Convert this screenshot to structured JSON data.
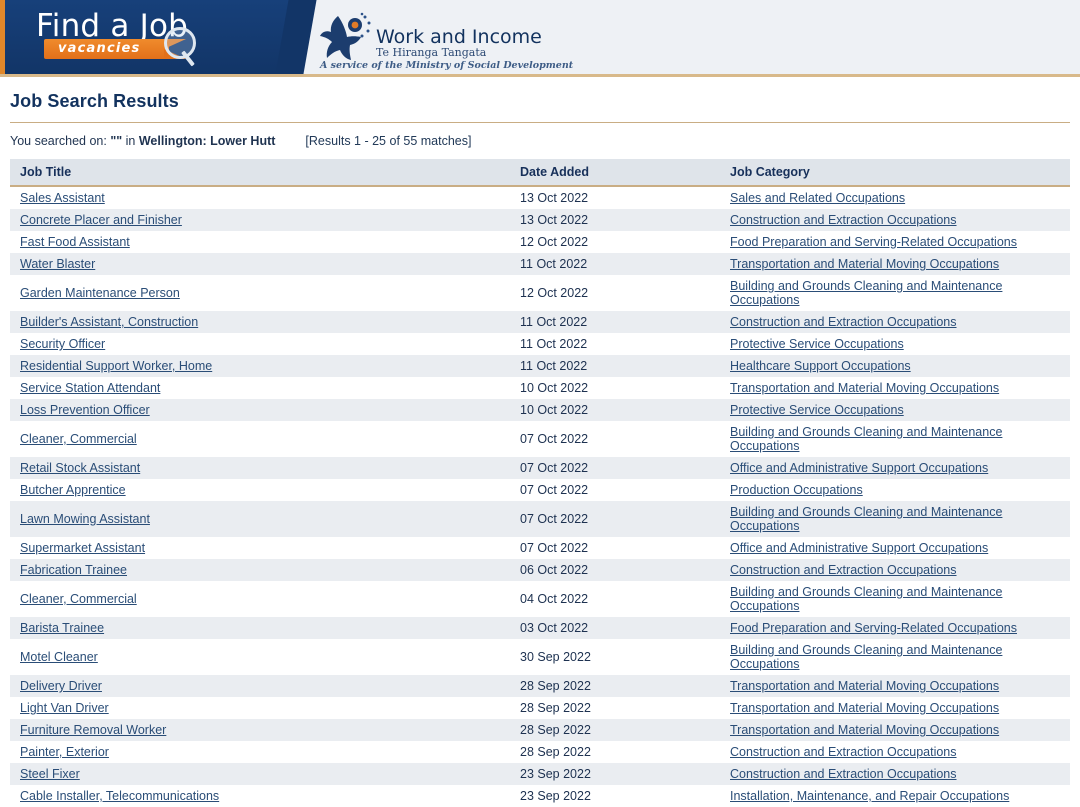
{
  "masthead": {
    "brand_logo_text": "Find a Job",
    "brand_banner_text": "vacancies",
    "agency_name": "Work and Income",
    "agency_maori_name": "Te Hiranga Tangata",
    "agency_tagline": "A service of the Ministry of Social Development",
    "navy": "#123567",
    "orange": "#e0872a",
    "rule_color": "#d8b98a"
  },
  "page": {
    "title": "Job Search Results",
    "searched_label": "You searched on: ",
    "searched_query": "\"\"",
    "searched_in": " in ",
    "searched_location": "Wellington: Lower Hutt",
    "results_count": "[Results 1 - 25 of 55 matches]"
  },
  "table": {
    "headers": {
      "job_title": "Job Title",
      "date_added": "Date Added",
      "job_category": "Job Category"
    },
    "rows": [
      {
        "title": "Sales Assistant",
        "date": "13 Oct 2022",
        "category": "Sales and Related Occupations"
      },
      {
        "title": "Concrete Placer and Finisher",
        "date": "13 Oct 2022",
        "category": "Construction and Extraction Occupations"
      },
      {
        "title": "Fast Food Assistant",
        "date": "12 Oct 2022",
        "category": "Food Preparation and Serving-Related Occupations"
      },
      {
        "title": "Water Blaster",
        "date": "11 Oct 2022",
        "category": "Transportation and Material Moving Occupations"
      },
      {
        "title": "Garden Maintenance Person",
        "date": "12 Oct 2022",
        "category": "Building and Grounds Cleaning and Maintenance Occupations"
      },
      {
        "title": "Builder's Assistant, Construction",
        "date": "11 Oct 2022",
        "category": "Construction and Extraction Occupations"
      },
      {
        "title": "Security Officer",
        "date": "11 Oct 2022",
        "category": "Protective Service Occupations"
      },
      {
        "title": "Residential Support Worker, Home",
        "date": "11 Oct 2022",
        "category": "Healthcare Support Occupations"
      },
      {
        "title": "Service Station Attendant",
        "date": "10 Oct 2022",
        "category": "Transportation and Material Moving Occupations"
      },
      {
        "title": "Loss Prevention Officer",
        "date": "10 Oct 2022",
        "category": "Protective Service Occupations"
      },
      {
        "title": "Cleaner, Commercial",
        "date": "07 Oct 2022",
        "category": "Building and Grounds Cleaning and Maintenance Occupations"
      },
      {
        "title": "Retail Stock Assistant",
        "date": "07 Oct 2022",
        "category": "Office and Administrative Support Occupations"
      },
      {
        "title": "Butcher Apprentice",
        "date": "07 Oct 2022",
        "category": "Production Occupations"
      },
      {
        "title": "Lawn Mowing Assistant",
        "date": "07 Oct 2022",
        "category": "Building and Grounds Cleaning and Maintenance Occupations"
      },
      {
        "title": "Supermarket Assistant",
        "date": "07 Oct 2022",
        "category": "Office and Administrative Support Occupations"
      },
      {
        "title": "Fabrication Trainee",
        "date": "06 Oct 2022",
        "category": "Construction and Extraction Occupations"
      },
      {
        "title": "Cleaner, Commercial",
        "date": "04 Oct 2022",
        "category": "Building and Grounds Cleaning and Maintenance Occupations"
      },
      {
        "title": "Barista Trainee",
        "date": "03 Oct 2022",
        "category": "Food Preparation and Serving-Related Occupations"
      },
      {
        "title": "Motel Cleaner",
        "date": "30 Sep 2022",
        "category": "Building and Grounds Cleaning and Maintenance Occupations"
      },
      {
        "title": "Delivery Driver",
        "date": "28 Sep 2022",
        "category": "Transportation and Material Moving Occupations"
      },
      {
        "title": "Light Van Driver",
        "date": "28 Sep 2022",
        "category": "Transportation and Material Moving Occupations"
      },
      {
        "title": "Furniture Removal Worker",
        "date": "28 Sep 2022",
        "category": "Transportation and Material Moving Occupations"
      },
      {
        "title": "Painter, Exterior",
        "date": "28 Sep 2022",
        "category": "Construction and Extraction Occupations"
      },
      {
        "title": "Steel Fixer",
        "date": "23 Sep 2022",
        "category": "Construction and Extraction Occupations"
      },
      {
        "title": "Cable Installer, Telecommunications",
        "date": "23 Sep 2022",
        "category": "Installation, Maintenance, and Repair Occupations"
      }
    ]
  }
}
